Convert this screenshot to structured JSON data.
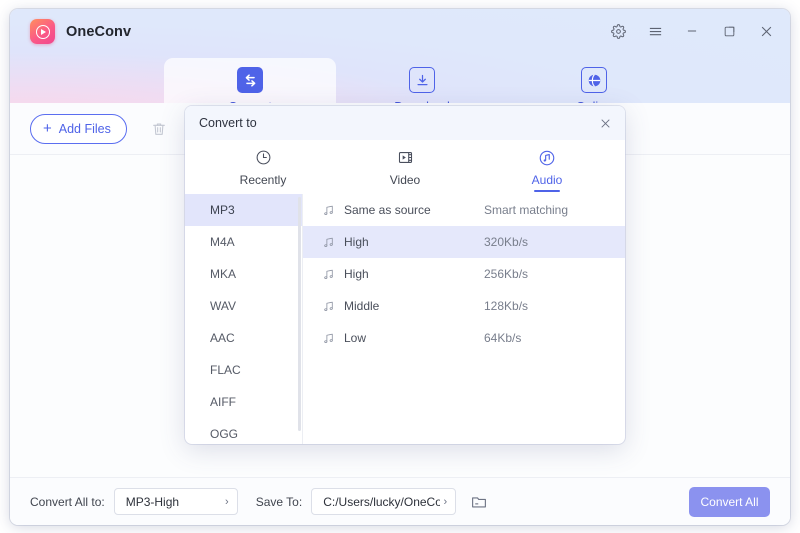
{
  "app": {
    "brand_name": "OneConv",
    "window_controls": [
      {
        "name": "settings-gear",
        "label": "Settings"
      },
      {
        "name": "menu-hamburger",
        "label": "Menu"
      },
      {
        "name": "minimize",
        "label": "Minimize"
      },
      {
        "name": "maximize",
        "label": "Maximize"
      },
      {
        "name": "close",
        "label": "Close"
      }
    ]
  },
  "nav": {
    "tabs": [
      {
        "label": "Convert",
        "icon": "convert-arrows-icon",
        "active": true
      },
      {
        "label": "Download",
        "icon": "download-icon",
        "active": false
      },
      {
        "label": "Online",
        "icon": "globe-icon",
        "active": false
      }
    ]
  },
  "toolbar": {
    "add_files_label": "Add Files",
    "plus_glyph": "+",
    "delete_icon": "trash-icon"
  },
  "modal": {
    "title": "Convert to",
    "close_glyph": "✕",
    "tabs": [
      {
        "label": "Recently",
        "icon": "clock-icon",
        "active": false
      },
      {
        "label": "Video",
        "icon": "video-icon",
        "active": false
      },
      {
        "label": "Audio",
        "icon": "audio-note-icon",
        "active": true
      }
    ],
    "formats": [
      {
        "label": "MP3",
        "selected": true
      },
      {
        "label": "M4A",
        "selected": false
      },
      {
        "label": "MKA",
        "selected": false
      },
      {
        "label": "WAV",
        "selected": false
      },
      {
        "label": "AAC",
        "selected": false
      },
      {
        "label": "FLAC",
        "selected": false
      },
      {
        "label": "AIFF",
        "selected": false
      },
      {
        "label": "OGG",
        "selected": false
      }
    ],
    "qualities": [
      {
        "name": "Same as source",
        "rate": "Smart matching",
        "selected": false
      },
      {
        "name": "High",
        "rate": "320Kb/s",
        "selected": true
      },
      {
        "name": "High",
        "rate": "256Kb/s",
        "selected": false
      },
      {
        "name": "Middle",
        "rate": "128Kb/s",
        "selected": false
      },
      {
        "name": "Low",
        "rate": "64Kb/s",
        "selected": false
      }
    ]
  },
  "bottom": {
    "convert_all_to_label": "Convert All to:",
    "format_value": "MP3-High",
    "save_to_label": "Save To:",
    "path_value": "C:/Users/lucky/OneCo...",
    "chevron_glyph": "›",
    "folder_icon": "folder-icon",
    "convert_all_button": "Convert All"
  },
  "colors": {
    "accent_blue": "#4f63e8",
    "button_purple": "#8b92ef",
    "selection_lavender": "#e2e5fb"
  }
}
